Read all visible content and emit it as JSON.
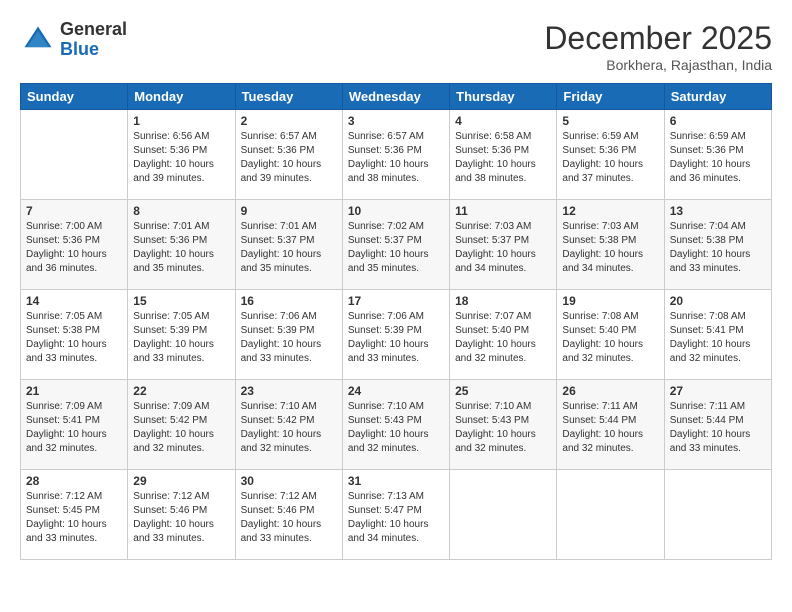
{
  "header": {
    "logo_general": "General",
    "logo_blue": "Blue",
    "month_title": "December 2025",
    "location": "Borkhera, Rajasthan, India"
  },
  "days_of_week": [
    "Sunday",
    "Monday",
    "Tuesday",
    "Wednesday",
    "Thursday",
    "Friday",
    "Saturday"
  ],
  "weeks": [
    [
      {
        "day": "",
        "info": ""
      },
      {
        "day": "1",
        "info": "Sunrise: 6:56 AM\nSunset: 5:36 PM\nDaylight: 10 hours\nand 39 minutes."
      },
      {
        "day": "2",
        "info": "Sunrise: 6:57 AM\nSunset: 5:36 PM\nDaylight: 10 hours\nand 39 minutes."
      },
      {
        "day": "3",
        "info": "Sunrise: 6:57 AM\nSunset: 5:36 PM\nDaylight: 10 hours\nand 38 minutes."
      },
      {
        "day": "4",
        "info": "Sunrise: 6:58 AM\nSunset: 5:36 PM\nDaylight: 10 hours\nand 38 minutes."
      },
      {
        "day": "5",
        "info": "Sunrise: 6:59 AM\nSunset: 5:36 PM\nDaylight: 10 hours\nand 37 minutes."
      },
      {
        "day": "6",
        "info": "Sunrise: 6:59 AM\nSunset: 5:36 PM\nDaylight: 10 hours\nand 36 minutes."
      }
    ],
    [
      {
        "day": "7",
        "info": "Sunrise: 7:00 AM\nSunset: 5:36 PM\nDaylight: 10 hours\nand 36 minutes."
      },
      {
        "day": "8",
        "info": "Sunrise: 7:01 AM\nSunset: 5:36 PM\nDaylight: 10 hours\nand 35 minutes."
      },
      {
        "day": "9",
        "info": "Sunrise: 7:01 AM\nSunset: 5:37 PM\nDaylight: 10 hours\nand 35 minutes."
      },
      {
        "day": "10",
        "info": "Sunrise: 7:02 AM\nSunset: 5:37 PM\nDaylight: 10 hours\nand 35 minutes."
      },
      {
        "day": "11",
        "info": "Sunrise: 7:03 AM\nSunset: 5:37 PM\nDaylight: 10 hours\nand 34 minutes."
      },
      {
        "day": "12",
        "info": "Sunrise: 7:03 AM\nSunset: 5:38 PM\nDaylight: 10 hours\nand 34 minutes."
      },
      {
        "day": "13",
        "info": "Sunrise: 7:04 AM\nSunset: 5:38 PM\nDaylight: 10 hours\nand 33 minutes."
      }
    ],
    [
      {
        "day": "14",
        "info": "Sunrise: 7:05 AM\nSunset: 5:38 PM\nDaylight: 10 hours\nand 33 minutes."
      },
      {
        "day": "15",
        "info": "Sunrise: 7:05 AM\nSunset: 5:39 PM\nDaylight: 10 hours\nand 33 minutes."
      },
      {
        "day": "16",
        "info": "Sunrise: 7:06 AM\nSunset: 5:39 PM\nDaylight: 10 hours\nand 33 minutes."
      },
      {
        "day": "17",
        "info": "Sunrise: 7:06 AM\nSunset: 5:39 PM\nDaylight: 10 hours\nand 33 minutes."
      },
      {
        "day": "18",
        "info": "Sunrise: 7:07 AM\nSunset: 5:40 PM\nDaylight: 10 hours\nand 32 minutes."
      },
      {
        "day": "19",
        "info": "Sunrise: 7:08 AM\nSunset: 5:40 PM\nDaylight: 10 hours\nand 32 minutes."
      },
      {
        "day": "20",
        "info": "Sunrise: 7:08 AM\nSunset: 5:41 PM\nDaylight: 10 hours\nand 32 minutes."
      }
    ],
    [
      {
        "day": "21",
        "info": "Sunrise: 7:09 AM\nSunset: 5:41 PM\nDaylight: 10 hours\nand 32 minutes."
      },
      {
        "day": "22",
        "info": "Sunrise: 7:09 AM\nSunset: 5:42 PM\nDaylight: 10 hours\nand 32 minutes."
      },
      {
        "day": "23",
        "info": "Sunrise: 7:10 AM\nSunset: 5:42 PM\nDaylight: 10 hours\nand 32 minutes."
      },
      {
        "day": "24",
        "info": "Sunrise: 7:10 AM\nSunset: 5:43 PM\nDaylight: 10 hours\nand 32 minutes."
      },
      {
        "day": "25",
        "info": "Sunrise: 7:10 AM\nSunset: 5:43 PM\nDaylight: 10 hours\nand 32 minutes."
      },
      {
        "day": "26",
        "info": "Sunrise: 7:11 AM\nSunset: 5:44 PM\nDaylight: 10 hours\nand 32 minutes."
      },
      {
        "day": "27",
        "info": "Sunrise: 7:11 AM\nSunset: 5:44 PM\nDaylight: 10 hours\nand 33 minutes."
      }
    ],
    [
      {
        "day": "28",
        "info": "Sunrise: 7:12 AM\nSunset: 5:45 PM\nDaylight: 10 hours\nand 33 minutes."
      },
      {
        "day": "29",
        "info": "Sunrise: 7:12 AM\nSunset: 5:46 PM\nDaylight: 10 hours\nand 33 minutes."
      },
      {
        "day": "30",
        "info": "Sunrise: 7:12 AM\nSunset: 5:46 PM\nDaylight: 10 hours\nand 33 minutes."
      },
      {
        "day": "31",
        "info": "Sunrise: 7:13 AM\nSunset: 5:47 PM\nDaylight: 10 hours\nand 34 minutes."
      },
      {
        "day": "",
        "info": ""
      },
      {
        "day": "",
        "info": ""
      },
      {
        "day": "",
        "info": ""
      }
    ]
  ]
}
